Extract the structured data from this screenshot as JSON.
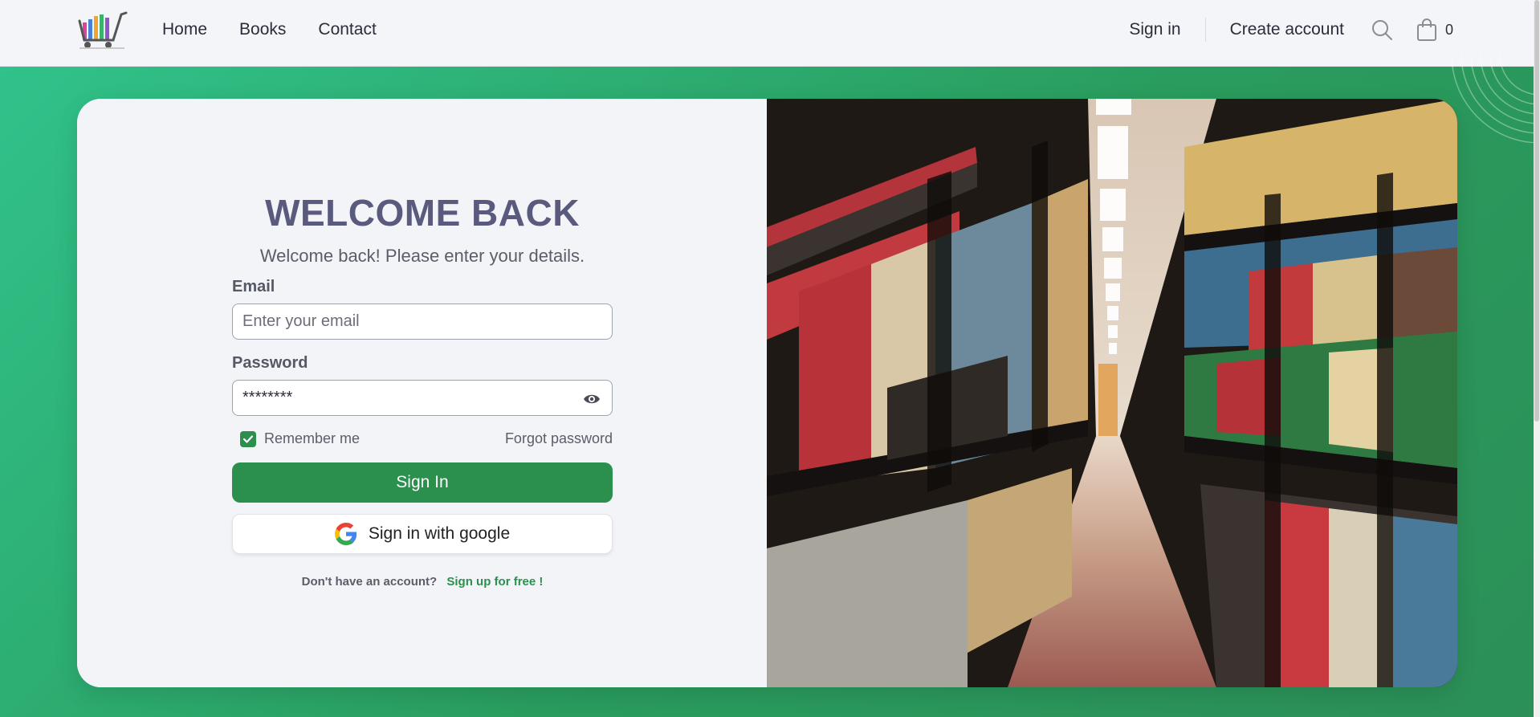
{
  "nav": {
    "links": [
      {
        "label": "Home"
      },
      {
        "label": "Books"
      },
      {
        "label": "Contact"
      }
    ],
    "sign_in": "Sign in",
    "create_account": "Create account",
    "cart_count": "0"
  },
  "login": {
    "title": "WELCOME BACK",
    "subtitle": "Welcome back! Please enter your details.",
    "email_label": "Email",
    "email_placeholder": "Enter your email",
    "password_label": "Password",
    "password_value": "********",
    "remember_label": "Remember me",
    "remember_checked": true,
    "forgot_label": "Forgot password",
    "submit_label": "Sign In",
    "google_label": "Sign in with google",
    "no_account_text": "Don't have an account?",
    "signup_label": "Sign up for free !"
  },
  "colors": {
    "accent": "#2b8f4e",
    "background_start": "#31c48d",
    "background_end": "#2b8f57",
    "title": "#5a5a7e"
  },
  "icons": [
    "cart-logo-icon",
    "search-icon",
    "shopping-bag-icon",
    "eye-icon",
    "check-icon",
    "google-icon"
  ]
}
